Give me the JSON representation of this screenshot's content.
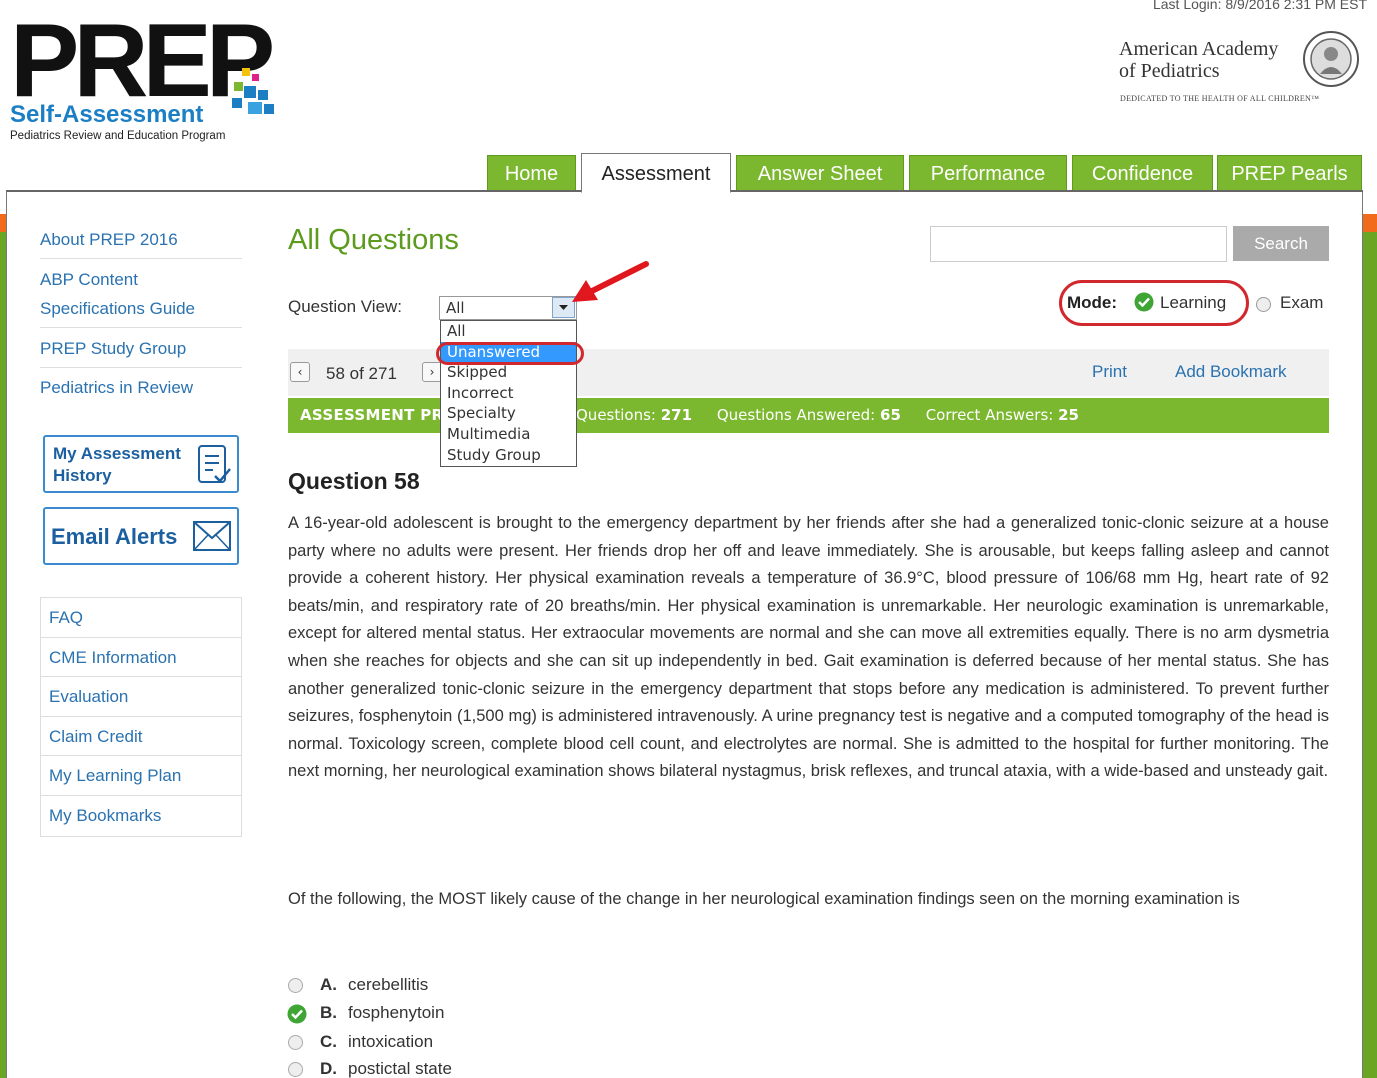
{
  "header": {
    "logo_title": "PREP",
    "logo_subtitle": "Self-Assessment",
    "logo_tagline": "Pediatrics Review and Education Program",
    "last_login": "Last Login: 8/9/2016 2:31 PM EST",
    "org_name_line1": "American Academy",
    "org_name_line2": "of Pediatrics",
    "org_tagline": "DEDICATED TO THE HEALTH OF ALL CHILDREN™"
  },
  "tabs": [
    {
      "label": "Home",
      "active": false
    },
    {
      "label": "Assessment",
      "active": true
    },
    {
      "label": "Answer Sheet",
      "active": false
    },
    {
      "label": "Performance",
      "active": false
    },
    {
      "label": "Confidence",
      "active": false
    },
    {
      "label": "PREP Pearls",
      "active": false
    }
  ],
  "left_nav": {
    "top_links": [
      "About PREP 2016",
      "ABP Content Specifications Guide",
      "PREP Study Group",
      "Pediatrics in Review"
    ],
    "promo_history": "My Assessment History",
    "promo_email": "Email Alerts",
    "bottom_links": [
      "FAQ",
      "CME Information",
      "Evaluation",
      "Claim Credit",
      "My Learning Plan",
      "My Bookmarks"
    ]
  },
  "main": {
    "title": "All Questions",
    "search_button": "Search",
    "search_value": "",
    "question_view_label": "Question View:",
    "question_view_selected": "All",
    "question_view_options": [
      "All",
      "Unanswered",
      "Skipped",
      "Incorrect",
      "Specialty",
      "Multimedia",
      "Study Group"
    ],
    "question_view_highlighted": "Unanswered",
    "mode_label": "Mode:",
    "mode_learning": "Learning",
    "mode_exam": "Exam",
    "mode_selected": "Learning",
    "pager_text": "58 of 271",
    "print": "Print",
    "add_bookmark": "Add Bookmark",
    "stats_title": "ASSESSMENT PREP 2016",
    "stats": {
      "questions_label": "Questions:",
      "questions": "271",
      "answered_label": "Questions Answered:",
      "answered": "65",
      "correct_label": "Correct Answers:",
      "correct": "25"
    },
    "question_title": "Question 58",
    "question_body": "A 16-year-old adolescent is brought to the emergency department by her friends after she had a generalized tonic-clonic seizure at a house party where no adults were present. Her friends drop her off and leave immediately. She is arousable, but keeps falling asleep and cannot provide a coherent history. Her physical examination reveals a temperature of 36.9°C, blood pressure of 106/68 mm Hg, heart rate of 92 beats/min, and respiratory rate of 20 breaths/min. Her physical examination is unremarkable. Her neurologic examination is unremarkable, except for altered mental status. Her extraocular movements are normal and she can move all extremities equally. There is no arm dysmetria when she reaches for objects and she can sit up independently in bed. Gait examination is deferred because of her mental status. She has another generalized tonic-clonic seizure in the emergency department that stops before any medication is administered. To prevent further seizures, fosphenytoin (1,500 mg) is administered intravenously. A urine pregnancy test is negative and a computed tomography of the head is normal. Toxicology screen, complete blood cell count, and electrolytes are normal. She is admitted to the hospital for further monitoring. The next morning, her neurological examination shows bilateral nystagmus, brisk reflexes, and truncal ataxia, with a wide-based and unsteady gait.",
    "question_stem": "Of the following, the MOST likely cause of the change in her neurological examination findings seen on the morning examination is",
    "answers": [
      {
        "letter": "A.",
        "text": "cerebellitis",
        "correct": false
      },
      {
        "letter": "B.",
        "text": "fosphenytoin",
        "correct": true
      },
      {
        "letter": "C.",
        "text": "intoxication",
        "correct": false
      },
      {
        "letter": "D.",
        "text": "postictal state",
        "correct": false
      }
    ]
  },
  "colors": {
    "green": "#7cb82f",
    "orange": "#f26b1d",
    "link_blue": "#2a72b0",
    "highlight_red": "#d0282d"
  }
}
